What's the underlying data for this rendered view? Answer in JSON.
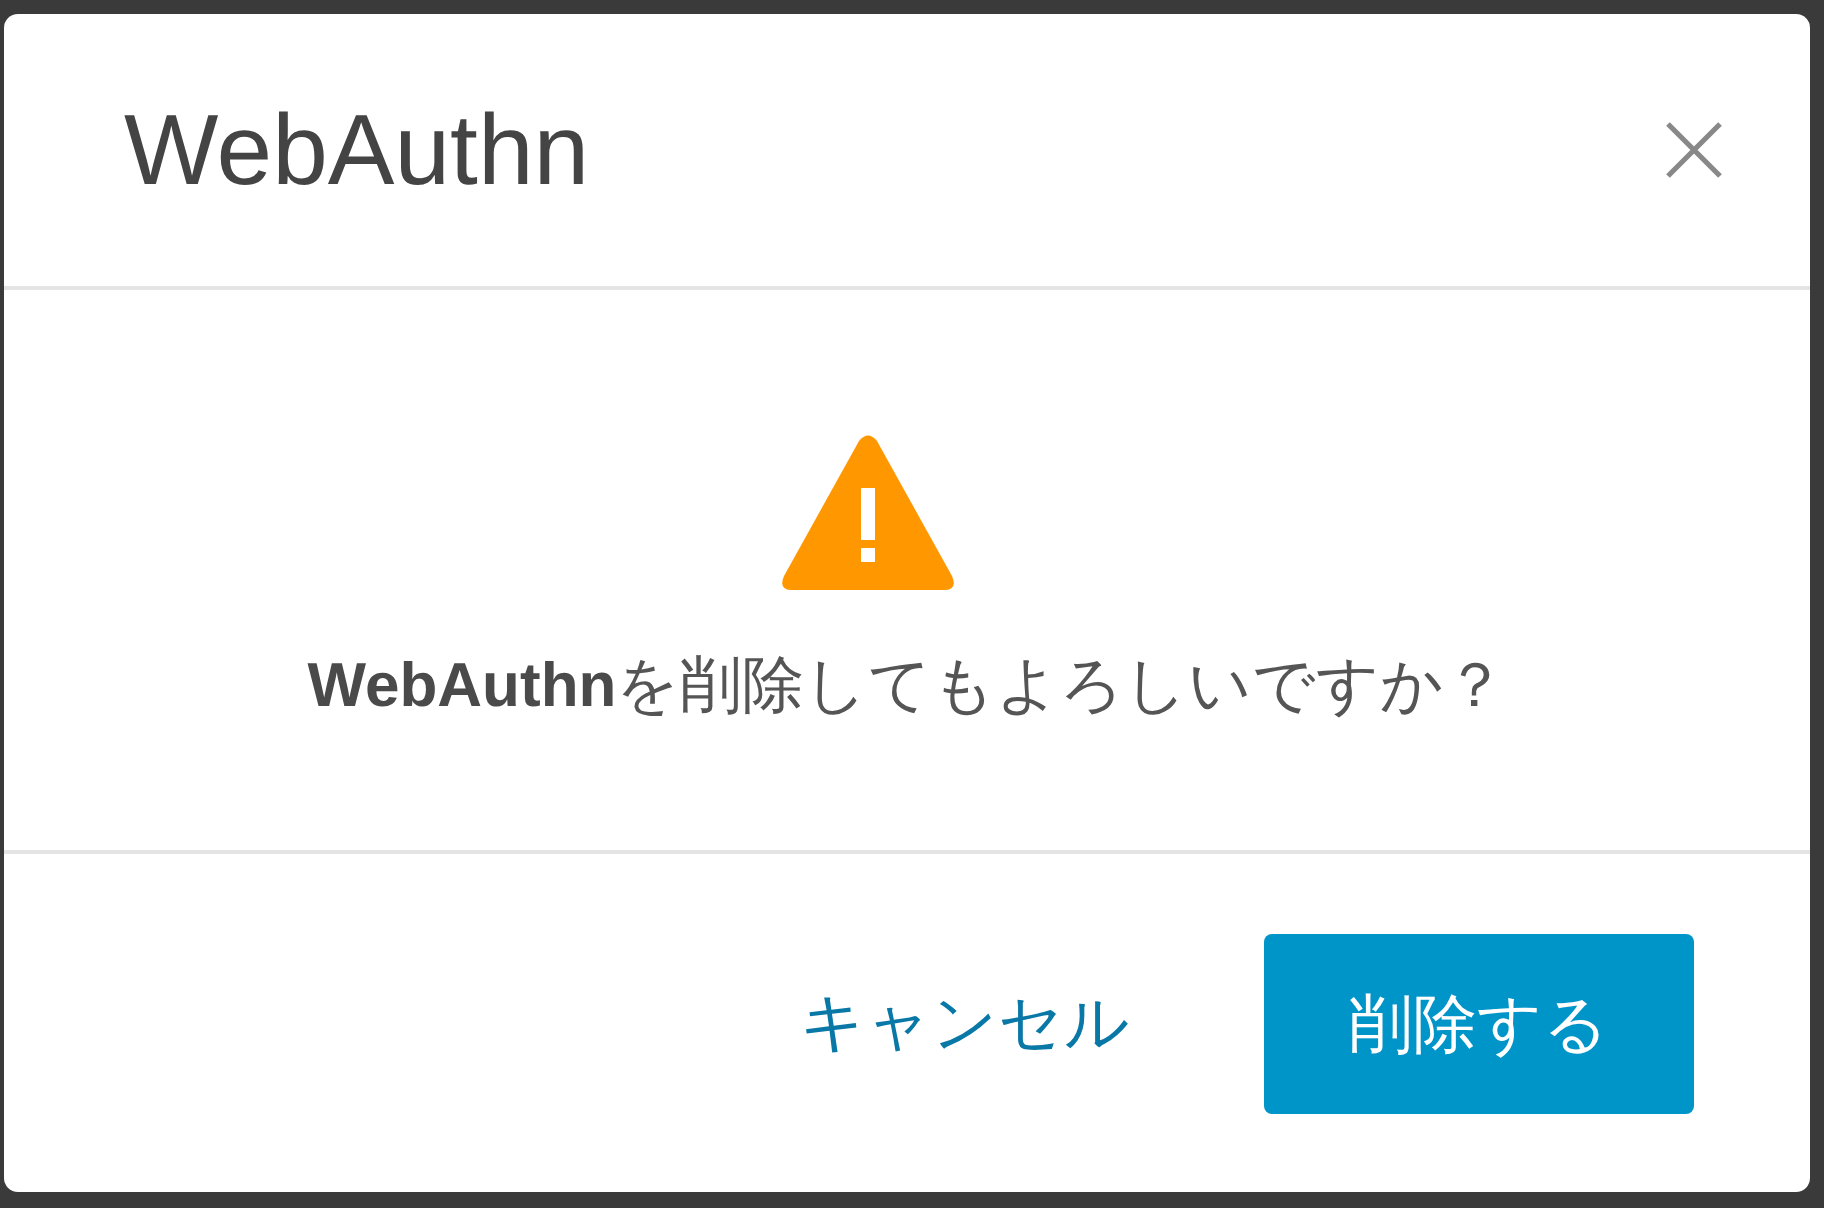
{
  "dialog": {
    "title": "WebAuthn",
    "message": "**WebAuthn**を削除してもよろしいですか？",
    "buttons": [
      {
        "label": "キャンセル",
        "kind": "link"
      },
      {
        "label": "削除する",
        "kind": "primary"
      }
    ]
  }
}
